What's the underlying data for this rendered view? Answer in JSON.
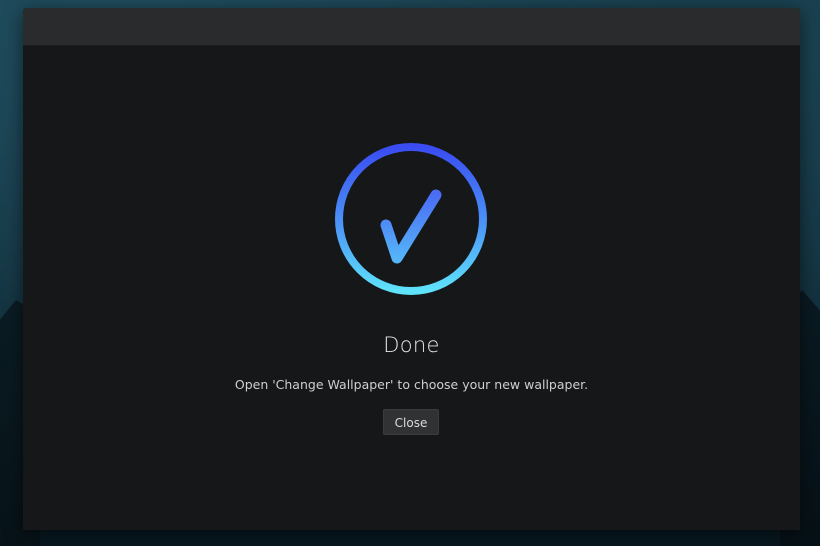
{
  "window": {
    "title": ""
  },
  "dialog": {
    "icon": "checkmark-circle-icon",
    "title": "Done",
    "message": "Open 'Change Wallpaper' to choose your new wallpaper.",
    "close_label": "Close"
  },
  "colors": {
    "icon_gradient_top": "#3a4cf2",
    "icon_gradient_bottom": "#5fe3fb",
    "window_background": "#151719",
    "titlebar": "#2a2b2d",
    "button_background": "#303234"
  }
}
